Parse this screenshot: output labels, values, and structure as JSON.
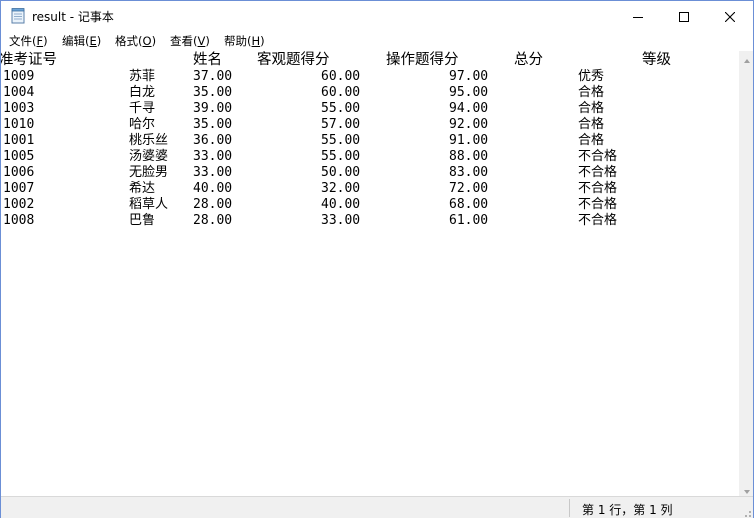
{
  "window": {
    "title": "result - 记事本",
    "app_icon": "notepad-icon",
    "controls": [
      "minimize-icon",
      "maximize-icon",
      "close-icon"
    ]
  },
  "menu": {
    "items": [
      {
        "label": "文件(",
        "key": "F",
        "end": ")"
      },
      {
        "label": "编辑(",
        "key": "E",
        "end": ")"
      },
      {
        "label": "格式(",
        "key": "O",
        "end": ")"
      },
      {
        "label": "查看(",
        "key": "V",
        "end": ")"
      },
      {
        "label": "帮助(",
        "key": "H",
        "end": ")"
      }
    ]
  },
  "document": {
    "headers": [
      "准考证号",
      "姓名",
      "客观题得分",
      "操作题得分",
      "总分",
      "等级"
    ],
    "rows": [
      [
        "1009",
        "苏菲",
        "37.00",
        "60.00",
        "97.00",
        "优秀"
      ],
      [
        "1004",
        "白龙",
        "35.00",
        "60.00",
        "95.00",
        "合格"
      ],
      [
        "1003",
        "千寻",
        "39.00",
        "55.00",
        "94.00",
        "合格"
      ],
      [
        "1010",
        "哈尔",
        "35.00",
        "57.00",
        "92.00",
        "合格"
      ],
      [
        "1001",
        "桃乐丝",
        "36.00",
        "55.00",
        "91.00",
        "合格"
      ],
      [
        "1005",
        "汤婆婆",
        "33.00",
        "55.00",
        "88.00",
        "不合格"
      ],
      [
        "1006",
        "无脸男",
        "33.00",
        "50.00",
        "83.00",
        "不合格"
      ],
      [
        "1007",
        "希达",
        "40.00",
        "32.00",
        "72.00",
        "不合格"
      ],
      [
        "1002",
        "稻草人",
        "28.00",
        "40.00",
        "68.00",
        "不合格"
      ],
      [
        "1008",
        "巴鲁",
        "28.00",
        "33.00",
        "61.00",
        "不合格"
      ]
    ]
  },
  "status": {
    "position": "第 1 行，第 1 列"
  },
  "colors": {
    "window_border": "#6b8fd6",
    "statusbar_bg": "#f0f0f0"
  }
}
